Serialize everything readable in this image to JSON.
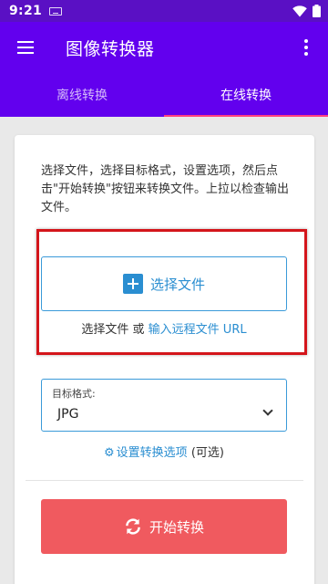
{
  "status_bar": {
    "time": "9:21"
  },
  "app_bar": {
    "title": "图像转换器"
  },
  "tabs": [
    {
      "label": "离线转换",
      "active": false
    },
    {
      "label": "在线转换",
      "active": true
    }
  ],
  "card": {
    "intro_text": "选择文件，选择目标格式，设置选项，然后点击\"开始转换\"按钮来转换文件。上拉以检查输出文件。",
    "select_file_label": "选择文件",
    "or_prefix": "选择文件 或",
    "remote_url_link": "输入远程文件 URL",
    "format_label": "目标格式:",
    "format_value": "JPG",
    "options_link": "设置转换选项",
    "options_suffix": "(可选)",
    "start_label": "开始转换"
  },
  "colors": {
    "status_bar": "#5a10c4",
    "primary": "#6200ee",
    "tab_indicator": "#ff4081",
    "link": "#2a8ed1",
    "start_button": "#f05a5f",
    "highlight_border": "#d4151b"
  },
  "icons": [
    "keyboard-icon",
    "wifi-icon",
    "battery-icon",
    "menu-icon",
    "more-vert-icon",
    "plus-icon",
    "chevron-down-icon",
    "gear-icon",
    "refresh-icon"
  ]
}
